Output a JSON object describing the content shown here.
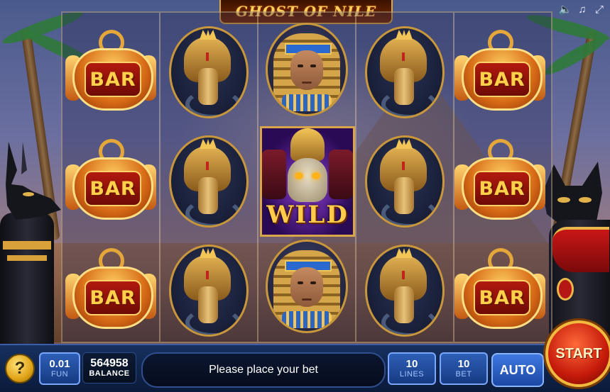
{
  "game": {
    "title": "GHOST OF NILE"
  },
  "top_icons": [
    "speaker-icon",
    "music-icon",
    "fullscreen-icon"
  ],
  "reels": [
    [
      "BAR",
      "BAR",
      "BAR"
    ],
    [
      "cobra",
      "cobra",
      "cobra"
    ],
    [
      "pharaoh",
      "WILD",
      "pharaoh"
    ],
    [
      "cobra",
      "cobra",
      "cobra"
    ],
    [
      "BAR",
      "BAR",
      "BAR"
    ]
  ],
  "symbols": {
    "bar_text": "BAR",
    "wild_text": "WILD"
  },
  "bottom_bar": {
    "help": "?",
    "coin_value": "0.01",
    "coin_label": "FUN",
    "balance_value": "564958",
    "balance_label": "BALANCE",
    "message": "Please place your bet",
    "lines_value": "10",
    "lines_label": "LINES",
    "bet_value": "10",
    "bet_label": "BET",
    "auto_label": "AUTO",
    "start_label": "START"
  }
}
